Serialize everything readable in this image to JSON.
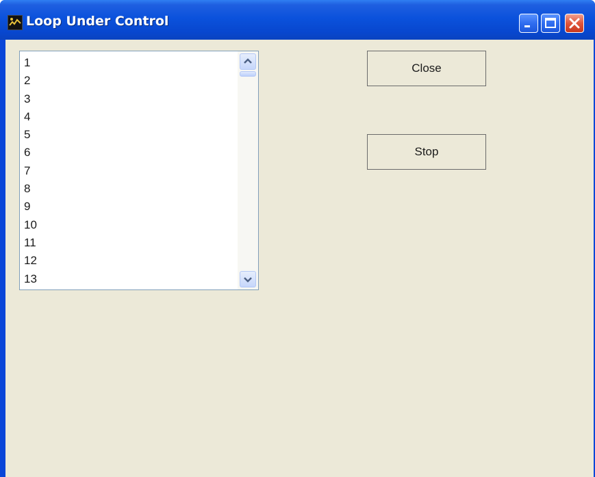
{
  "window": {
    "title": "Loop Under Control",
    "icon": "app-icon"
  },
  "titlebar_buttons": {
    "minimize_icon": "minimize-icon",
    "maximize_icon": "maximize-icon",
    "close_icon": "close-icon"
  },
  "listbox": {
    "items": [
      "1",
      "2",
      "3",
      "4",
      "5",
      "6",
      "7",
      "8",
      "9",
      "10",
      "11",
      "12",
      "13"
    ]
  },
  "buttons": {
    "close_label": "Close",
    "stop_label": "Stop"
  },
  "colors": {
    "titlebar": "#0b52dc",
    "client_bg": "#ece9d8",
    "close_button": "#e0553a"
  }
}
